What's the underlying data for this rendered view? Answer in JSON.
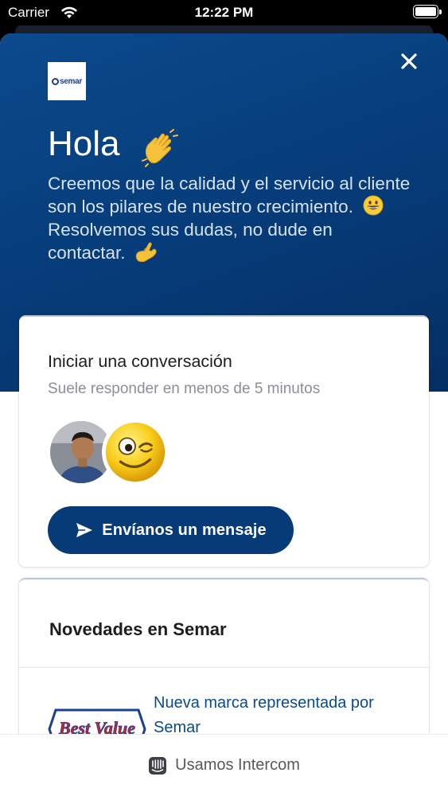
{
  "status_bar": {
    "carrier": "Carrier",
    "time": "12:22 PM"
  },
  "header": {
    "logo_text": "semar",
    "greeting": "Hola",
    "intro_line1": "Creemos que la calidad y el servicio al cliente son los pilares de nuestro crecimiento.",
    "intro_line2": "Resolvemos sus dudas, no dude en contactar."
  },
  "conversation": {
    "title": "Iniciar una conversación",
    "subtitle": "Suele responder en menos de 5 minutos",
    "send_label": "Envíanos un mensaje"
  },
  "news": {
    "title": "Novedades en Semar",
    "items": [
      {
        "thumb_text": "Best Value",
        "text": "Nueva marca representada por Semar"
      }
    ]
  },
  "footer": {
    "label": "Usamos Intercom"
  },
  "colors": {
    "brand": "#063b78",
    "link": "#0a4a8e"
  }
}
